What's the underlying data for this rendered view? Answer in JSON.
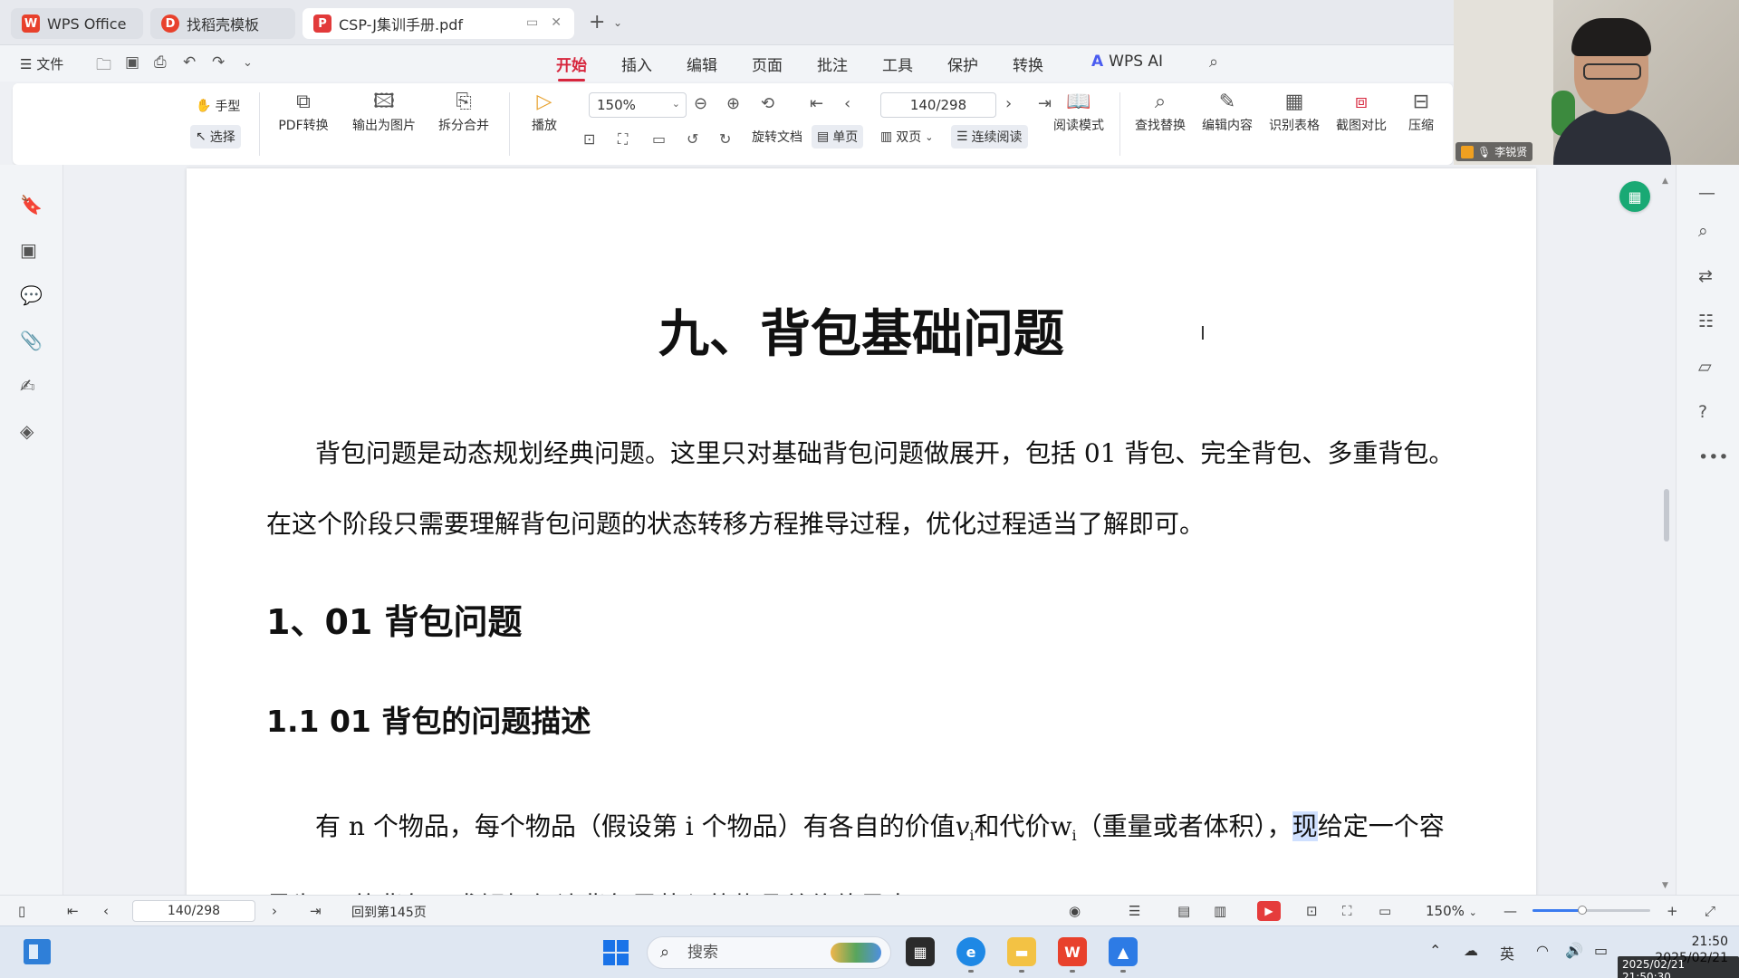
{
  "tabs": [
    {
      "title": "WPS Office",
      "logo": "W",
      "color": "#e8412c"
    },
    {
      "title": "找稻壳模板",
      "logo": "D",
      "color": "#e8412c"
    },
    {
      "title": "CSP-J集训手册.pdf",
      "logo": "P",
      "color": "#e23a3a"
    }
  ],
  "menu": {
    "file": "文件",
    "tabs": [
      "开始",
      "插入",
      "编辑",
      "页面",
      "批注",
      "工具",
      "保护",
      "转换"
    ],
    "active": "开始",
    "ai": "WPS AI"
  },
  "ribbon": {
    "hand": "手型",
    "select": "选择",
    "pdf_convert": "PDF转换",
    "export_image": "输出为图片",
    "split_merge": "拆分合并",
    "play": "播放",
    "zoom": "150%",
    "page": "140/298",
    "rotate": "旋转文档",
    "single": "单页",
    "double": "双页",
    "continuous": "连续阅读",
    "read_mode": "阅读模式",
    "find_replace": "查找替换",
    "edit_content": "编辑内容",
    "recognize_table": "识别表格",
    "screenshot_compare": "截图对比",
    "compress": "压缩"
  },
  "webcam": {
    "name": "李锐贤"
  },
  "document": {
    "title": "九、背包基础问题",
    "para1": "背包问题是动态规划经典问题。这里只对基础背包问题做展开，包括 01 背包、完全背包、多重背包。在这个阶段只需要理解背包问题的状态转移方程推导过程，优化过程适当了解即可。",
    "h1": "1、01 背包问题",
    "h2": "1.1 01 背包的问题描述",
    "para2_a": "有 n 个物品，每个物品（假设第 i 个物品）有各自的价值",
    "para2_v": "v",
    "para2_b": "和代价",
    "para2_w": "w",
    "para2_sub": "i",
    "para2_c": "（重量或者体积），",
    "para2_hl": "现",
    "para2_d": "给定一个容量为 C 的背包，求解如何让背包里装入的物品总价值最大。"
  },
  "status": {
    "page": "140/298",
    "back": "回到第145页",
    "zoom": "150%",
    "zoom_fraction": 0.42
  },
  "taskbar": {
    "search": "搜索",
    "time": "21:50",
    "date": "2025/02/21",
    "ime": "英",
    "stamp": "2025/02/21 21:50:30"
  }
}
